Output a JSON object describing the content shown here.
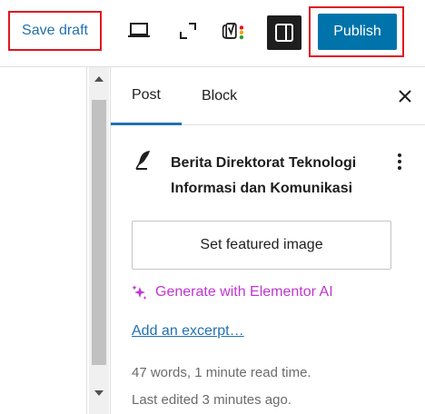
{
  "toolbar": {
    "save_draft_label": "Save draft",
    "publish_label": "Publish",
    "icons": [
      "desktop-preview-icon",
      "fullscreen-icon",
      "yoast-seo-icon",
      "settings-sidebar-icon"
    ]
  },
  "sidebar": {
    "tabs": [
      {
        "label": "Post",
        "active": true
      },
      {
        "label": "Block",
        "active": false
      }
    ],
    "post_title": "Berita Direktorat Teknologi Informasi dan Komunikasi",
    "featured_image_label": "Set featured image",
    "elementor_ai_label": "Generate with Elementor AI",
    "excerpt_link_label": "Add an excerpt…",
    "word_count_text": "47 words, 1 minute read time.",
    "last_edited_text": "Last edited 3 minutes ago."
  },
  "colors": {
    "accent": "#0073aa",
    "link": "#2271b1",
    "highlight_border": "#e0161e",
    "elementor": "#c036d0"
  }
}
